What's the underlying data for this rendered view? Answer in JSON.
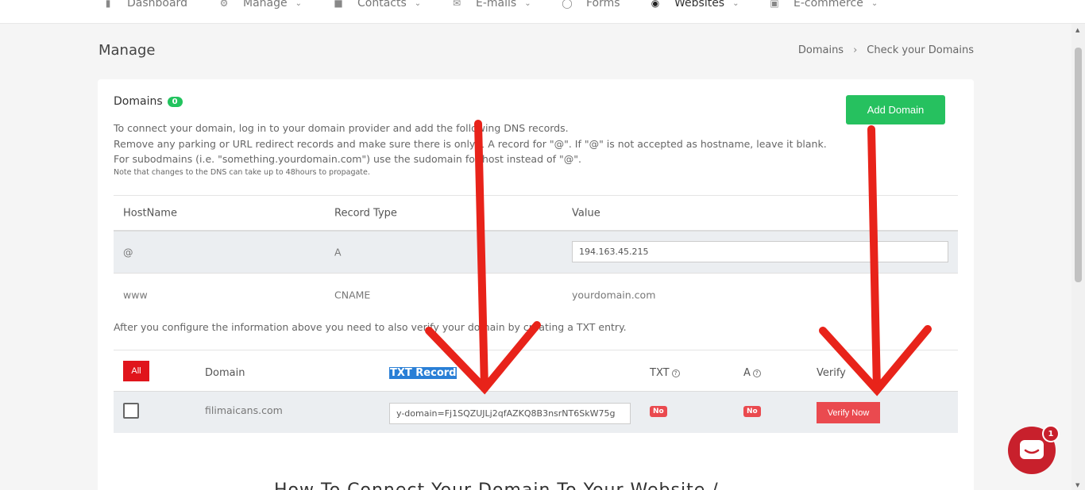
{
  "nav": {
    "items": [
      {
        "label": "Dashboard",
        "icon": "bar-chart-icon"
      },
      {
        "label": "Manage",
        "icon": "gear-icon"
      },
      {
        "label": "Contacts",
        "icon": "contacts-icon"
      },
      {
        "label": "E-mails",
        "icon": "mail-icon"
      },
      {
        "label": "Forms",
        "icon": "form-icon"
      },
      {
        "label": "Websites",
        "icon": "globe-icon"
      },
      {
        "label": "E-commerce",
        "icon": "shop-icon"
      }
    ]
  },
  "header": {
    "title": "Manage",
    "breadcrumb": [
      "Domains",
      "Check your Domains"
    ]
  },
  "card": {
    "title": "Domains",
    "count": "0",
    "add_button": "Add Domain",
    "instructions": [
      "To connect your domain, log in to your domain provider and add the following DNS records.",
      "Remove any parking or URL redirect records and make sure there is only 1 A record for \"@\". If \"@\" is not accepted as hostname, leave it blank.",
      "For subodmains (i.e. \"something.yourdomain.com\") use the sudomain for host instead of \"@\"."
    ],
    "note": "Note that changes to the DNS can take up to 48hours to propagate."
  },
  "dns_table": {
    "headers": [
      "HostName",
      "Record Type",
      "Value"
    ],
    "rows": [
      {
        "host": "@",
        "type": "A",
        "value": "194.163.45.215"
      },
      {
        "host": "www",
        "type": "CNAME",
        "value": "yourdomain.com"
      }
    ]
  },
  "after_text": "After you configure the information above you need to also verify your domain by creating a TXT entry.",
  "verify_table": {
    "all_button": "All",
    "headers": [
      "Domain",
      "TXT Record",
      "TXT",
      "A",
      "Verify"
    ],
    "row": {
      "domain": "filimaicans.com",
      "txt_value": "y-domain=Fj1SQZUJLj2qfAZKQ8B3nsrNT6SkW75g",
      "txt_status": "No",
      "a_status": "No",
      "verify_button": "Verify Now"
    }
  },
  "bottom_heading": "How To Connect Your Domain To Your Website /",
  "chat": {
    "badge": "1"
  },
  "colors": {
    "accent_green": "#26c15f",
    "danger": "#ea4a4f",
    "arrow": "#e8231a"
  }
}
